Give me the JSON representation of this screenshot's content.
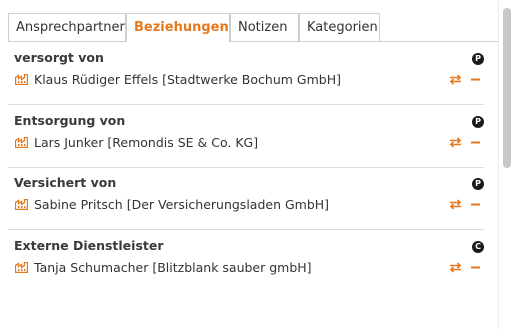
{
  "tabs": [
    {
      "label": "Ansprechpartner"
    },
    {
      "label": "Beziehungen"
    },
    {
      "label": "Notizen"
    },
    {
      "label": "Kategorien"
    }
  ],
  "active_tab": "Beziehungen",
  "colors": {
    "accent": "#e6781e",
    "badge": "#1a1a1a"
  },
  "sections": [
    {
      "title": "versorgt von",
      "badge": "P",
      "entry": "Klaus Rüdiger Effels [Stadtwerke Bochum GmbH]",
      "entry_icon": "company-icon"
    },
    {
      "title": "Entsorgung von",
      "badge": "P",
      "entry": "Lars Junker [Remondis SE & Co. KG]",
      "entry_icon": "company-icon"
    },
    {
      "title": "Versichert von",
      "badge": "P",
      "entry": "Sabine Pritsch [Der Versicherungsladen GmbH]",
      "entry_icon": "company-icon"
    },
    {
      "title": "Externe Dienstleister",
      "badge": "C",
      "entry": "Tanja Schumacher [Blitzblank sauber gmbH]",
      "entry_icon": "company-icon"
    }
  ]
}
